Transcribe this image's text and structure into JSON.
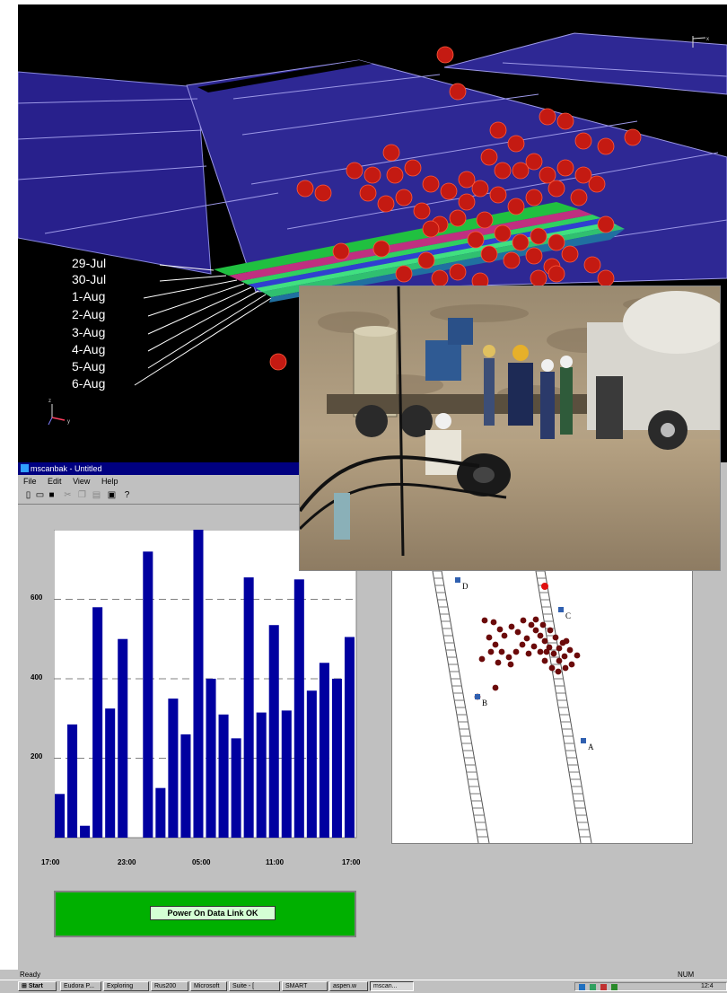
{
  "scene": {
    "dates": [
      "29-Jul",
      "30-Jul",
      "1-Aug",
      "2-Aug",
      "3-Aug",
      "4-Aug",
      "5-Aug",
      "6-Aug"
    ],
    "axes": {
      "x": "x",
      "y": "y",
      "z": "z"
    }
  },
  "app": {
    "title": "mscanbak - Untitled",
    "menu": [
      "File",
      "Edit",
      "View",
      "Help"
    ],
    "status_panel": "Power On    Data Link OK",
    "status_ready": "Ready",
    "status_num": "NUM"
  },
  "chart_data": {
    "type": "bar",
    "x_tick_labels": [
      "17:00",
      "23:00",
      "05:00",
      "11:00",
      "17:00"
    ],
    "y_tick_labels": [
      "200",
      "400",
      "600"
    ],
    "ylim": [
      0,
      775
    ],
    "gridlines": [
      200,
      400,
      600
    ],
    "values": [
      110,
      285,
      30,
      580,
      325,
      500,
      0,
      720,
      125,
      350,
      260,
      775,
      400,
      310,
      250,
      655,
      315,
      535,
      320,
      650,
      370,
      440,
      400,
      505
    ],
    "bar_color": "#0000a0"
  },
  "plan": {
    "labels": [
      "D",
      "C",
      "B",
      "A"
    ]
  },
  "taskbar": {
    "start": "Start",
    "tasks": [
      "Eudora P...",
      "Exploring",
      "Rus200",
      "Microsoft",
      "Suite - [",
      "SMART",
      "aspen.w",
      "mscan..."
    ],
    "clock": "12:4"
  }
}
